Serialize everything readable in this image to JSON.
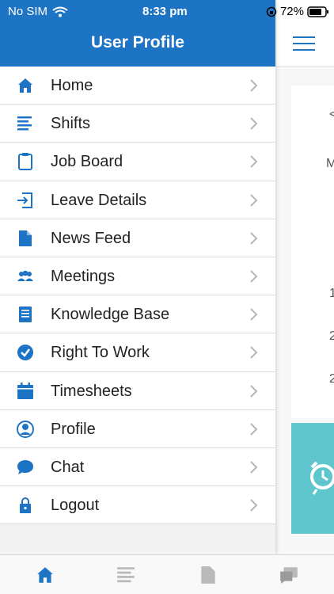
{
  "status_bar": {
    "carrier": "No SIM",
    "time": "8:33 pm",
    "battery": "72%"
  },
  "drawer": {
    "title": "User Profile",
    "items": [
      {
        "label": "Home",
        "icon": "home-icon"
      },
      {
        "label": "Shifts",
        "icon": "list-lines-icon"
      },
      {
        "label": "Job Board",
        "icon": "clipboard-icon"
      },
      {
        "label": "Leave Details",
        "icon": "sign-in-icon"
      },
      {
        "label": "News Feed",
        "icon": "document-icon"
      },
      {
        "label": "Meetings",
        "icon": "group-icon"
      },
      {
        "label": "Knowledge Base",
        "icon": "book-icon"
      },
      {
        "label": "Right To Work",
        "icon": "check-circle-icon"
      },
      {
        "label": "Timesheets",
        "icon": "calendar-icon"
      },
      {
        "label": "Profile",
        "icon": "user-circle-icon"
      },
      {
        "label": "Chat",
        "icon": "chat-bubble-icon"
      },
      {
        "label": "Logout",
        "icon": "lock-icon"
      }
    ]
  },
  "background_page": {
    "fragments": [
      "<",
      "M",
      "1",
      "2",
      "2"
    ]
  },
  "tab_bar": {
    "tabs": [
      "home-icon",
      "list-lines-icon",
      "document-icon",
      "chat-icon"
    ]
  },
  "colors": {
    "primary": "#1e74c4",
    "accent_teal": "#5ec6cc",
    "icon_blue": "#1e74c4",
    "tab_inactive": "#b9b9b9"
  }
}
